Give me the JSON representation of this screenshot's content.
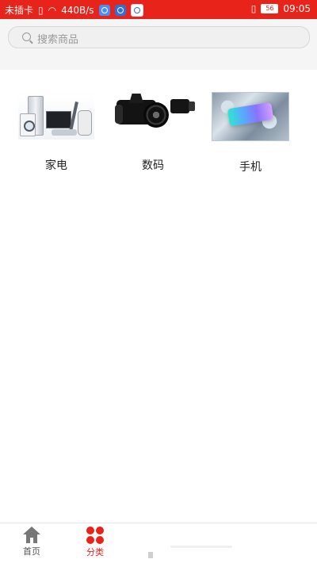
{
  "status_bar": {
    "carrier": "未插卡",
    "speed": "440B/s",
    "battery": "56",
    "time": "09:05"
  },
  "search": {
    "placeholder": "搜索商品"
  },
  "categories": [
    {
      "label": "家电"
    },
    {
      "label": "数码"
    },
    {
      "label": "手机"
    }
  ],
  "bottom_nav": {
    "items": [
      {
        "label": "首页"
      },
      {
        "label": "分类"
      }
    ]
  },
  "colors": {
    "accent": "#e8231a"
  }
}
